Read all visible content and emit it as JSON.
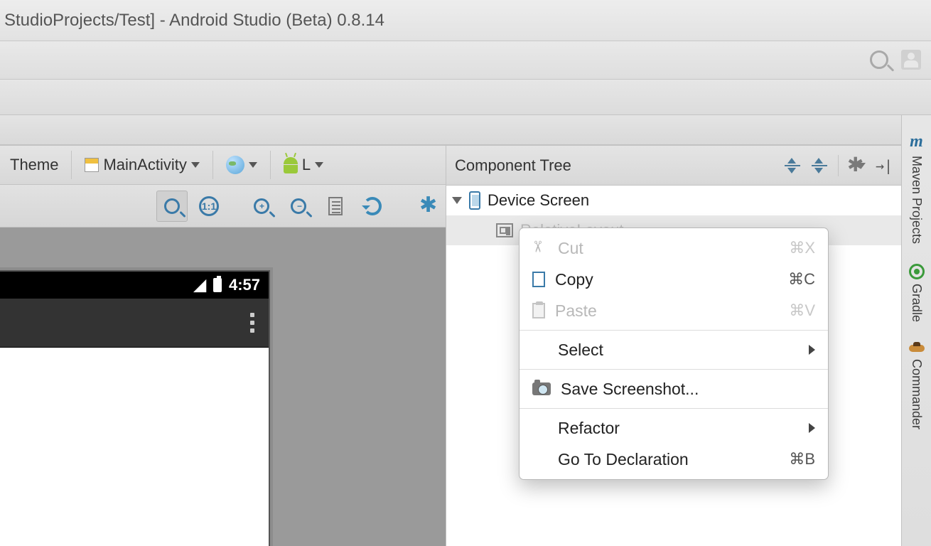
{
  "window": {
    "title": "StudioProjects/Test] - Android Studio (Beta) 0.8.14"
  },
  "designer_toolbar": {
    "theme_label": "Theme",
    "activity_label": "MainActivity",
    "api_label": "L"
  },
  "component_tree": {
    "title": "Component Tree",
    "root_label": "Device Screen",
    "child_label": "RelativeLayout"
  },
  "preview": {
    "status_time": "4:57"
  },
  "context_menu": {
    "cut": {
      "label": "Cut",
      "shortcut": "⌘X"
    },
    "copy": {
      "label": "Copy",
      "shortcut": "⌘C"
    },
    "paste": {
      "label": "Paste",
      "shortcut": "⌘V"
    },
    "select": {
      "label": "Select"
    },
    "screenshot": {
      "label": "Save Screenshot..."
    },
    "refactor": {
      "label": "Refactor"
    },
    "goto_decl": {
      "label": "Go To Declaration",
      "shortcut": "⌘B"
    }
  },
  "right_strip": {
    "maven": "Maven Projects",
    "gradle": "Gradle",
    "commander": "Commander"
  }
}
